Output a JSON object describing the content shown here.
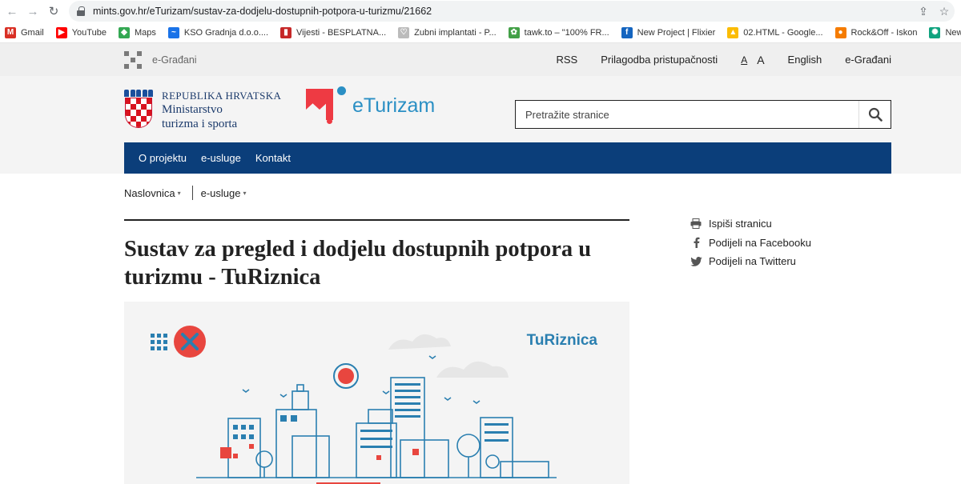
{
  "browser": {
    "url": "mints.gov.hr/eTurizam/sustav-za-dodjelu-dostupnih-potpora-u-turizmu/21662",
    "bookmarks": [
      {
        "label": "Gmail",
        "icon": "gmail-icon",
        "color": "#d93025",
        "glyph": "M"
      },
      {
        "label": "YouTube",
        "icon": "youtube-icon",
        "color": "#ff0000",
        "glyph": "▶"
      },
      {
        "label": "Maps",
        "icon": "maps-icon",
        "color": "#34a853",
        "glyph": "◆"
      },
      {
        "label": "KSO Gradnja d.o.o....",
        "icon": "kso-icon",
        "color": "#1a73e8",
        "glyph": "~"
      },
      {
        "label": "Vijesti - BESPLATNA...",
        "icon": "vijesti-icon",
        "color": "#c62828",
        "glyph": "▮"
      },
      {
        "label": "Zubni implantati - P...",
        "icon": "zubni-icon",
        "color": "#bbbbbb",
        "glyph": "♡"
      },
      {
        "label": "tawk.to – \"100% FR...",
        "icon": "tawk-icon",
        "color": "#43a047",
        "glyph": "✿"
      },
      {
        "label": "New Project | Flixier",
        "icon": "flixier-icon",
        "color": "#1565c0",
        "glyph": "f"
      },
      {
        "label": "02.HTML - Google...",
        "icon": "drive-icon",
        "color": "#fbbc04",
        "glyph": "▲"
      },
      {
        "label": "Rock&Off - Iskon",
        "icon": "iskon-icon",
        "color": "#f57c00",
        "glyph": "●"
      },
      {
        "label": "New chat",
        "icon": "chat-icon",
        "color": "#10a37f",
        "glyph": "✺"
      }
    ]
  },
  "utility": {
    "portal": "e-Građani",
    "links": [
      "RSS",
      "Prilagodba pristupačnosti"
    ],
    "font_small": "A",
    "font_big": "A",
    "language": "English",
    "portal_link": "e-Građani"
  },
  "header": {
    "ministry_line1": "REPUBLIKA HRVATSKA",
    "ministry_line2": "Ministarstvo",
    "ministry_line3": "turizma i sporta",
    "brand": "eTurizam",
    "search_placeholder": "Pretražite stranice"
  },
  "nav": {
    "items": [
      "O projektu",
      "e-usluge",
      "Kontakt"
    ]
  },
  "breadcrumb": [
    "Naslovnica",
    "e-usluge"
  ],
  "article": {
    "title": "Sustav za pregled i dodjelu dostupnih potpora u turizmu - TuRiznica",
    "hero_brand": "TuRiznica"
  },
  "share": {
    "print": "Ispiši stranicu",
    "facebook": "Podijeli na Facebooku",
    "twitter": "Podijeli na Twitteru"
  },
  "colors": {
    "nav_blue": "#0b3e7a",
    "brand_blue": "#2a8fc4",
    "brand_red": "#ee3a43"
  }
}
